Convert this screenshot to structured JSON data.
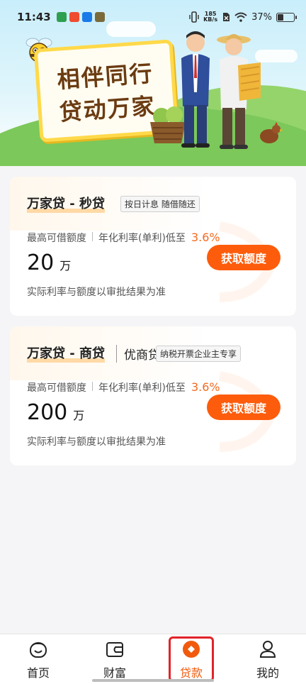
{
  "status_bar": {
    "time": "11:43",
    "net_speed_value": "185",
    "net_speed_unit": "KB/s",
    "battery": "37%",
    "battery_level": 0.37
  },
  "banner": {
    "line1": "相伴同行",
    "line2": "贷动万家"
  },
  "loans": [
    {
      "title": "万家贷 - 秒贷",
      "subtitle": "",
      "tag": "按日计息 随借随还",
      "max_label": "最高可借额度",
      "rate_label": "年化利率(单利)低至",
      "rate_value": "3.6%",
      "amount": "20",
      "amount_unit": "万",
      "button": "获取额度",
      "note": "实际利率与额度以审批结果为准"
    },
    {
      "title": "万家贷 - 商贷",
      "subtitle": "优商贷",
      "tag": "纳税开票企业主专享",
      "max_label": "最高可借额度",
      "rate_label": "年化利率(单利)低至",
      "rate_value": "3.6%",
      "amount": "200",
      "amount_unit": "万",
      "button": "获取额度",
      "note": "实际利率与额度以审批结果为准"
    }
  ],
  "nav": {
    "items": [
      {
        "label": "首页",
        "icon": "home-face-icon"
      },
      {
        "label": "财富",
        "icon": "wallet-icon"
      },
      {
        "label": "贷款",
        "icon": "loan-diamond-icon"
      },
      {
        "label": "我的",
        "icon": "person-icon"
      }
    ],
    "active_index": 2
  },
  "colors": {
    "accent": "#fd5c0c",
    "active_tab": "#f15a0d",
    "highlight_box": "#e2232a",
    "rate_value": "#f26a21"
  }
}
